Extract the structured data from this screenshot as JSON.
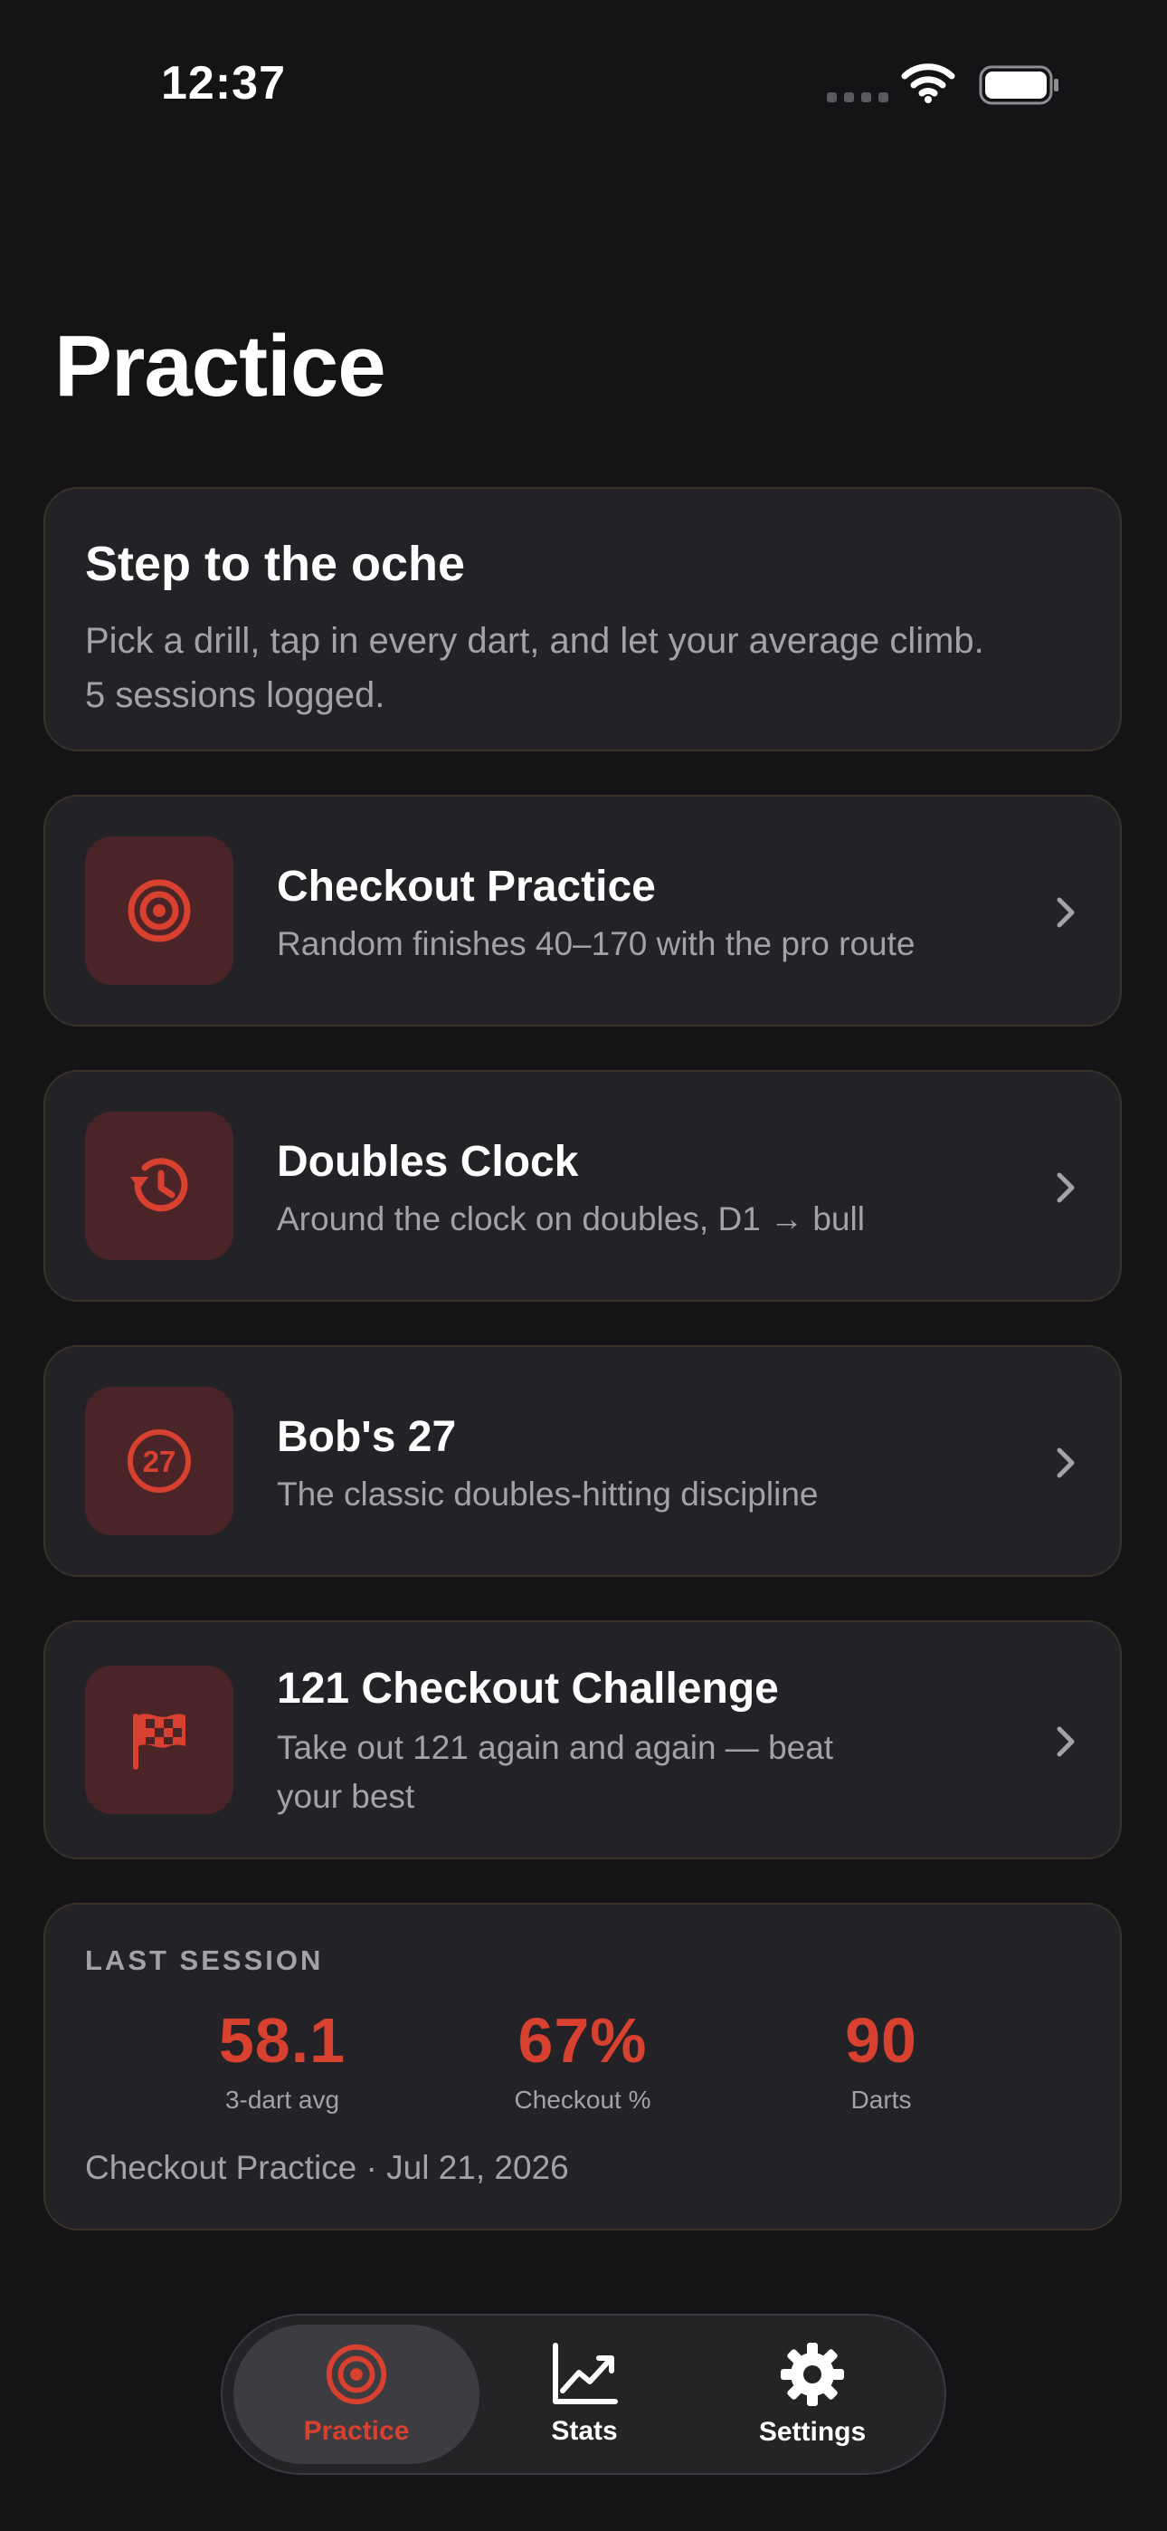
{
  "status": {
    "time": "12:37"
  },
  "page": {
    "title": "Practice"
  },
  "intro": {
    "title": "Step to the oche",
    "line1": "Pick a drill, tap in every dart, and let your average climb.",
    "line2": "5 sessions logged."
  },
  "drills": [
    {
      "title": "Checkout Practice",
      "subtitle": "Random finishes 40–170 with the pro route",
      "icon": "target-icon"
    },
    {
      "title": "Doubles Clock",
      "subtitle": "Around the clock on doubles, D1 → bull",
      "icon": "history-clock-icon"
    },
    {
      "title": "Bob's 27",
      "subtitle": "The classic doubles-hitting discipline",
      "icon": "badge-27-icon"
    },
    {
      "title": "121 Checkout Challenge",
      "subtitle": "Take out 121 again and again — beat your best",
      "icon": "checkered-flag-icon"
    }
  ],
  "last_session": {
    "label": "LAST SESSION",
    "stats": [
      {
        "value": "58.1",
        "label": "3-dart avg"
      },
      {
        "value": "67%",
        "label": "Checkout %"
      },
      {
        "value": "90",
        "label": "Darts"
      }
    ],
    "footer": "Checkout Practice · Jul 21, 2026"
  },
  "tabs": [
    {
      "label": "Practice",
      "icon": "target-icon",
      "active": true
    },
    {
      "label": "Stats",
      "icon": "chart-icon",
      "active": false
    },
    {
      "label": "Settings",
      "icon": "gear-icon",
      "active": false
    }
  ],
  "colors": {
    "accent": "#d8402f",
    "background": "#141416",
    "card": "#232226",
    "icon_tile": "#4a2426"
  }
}
